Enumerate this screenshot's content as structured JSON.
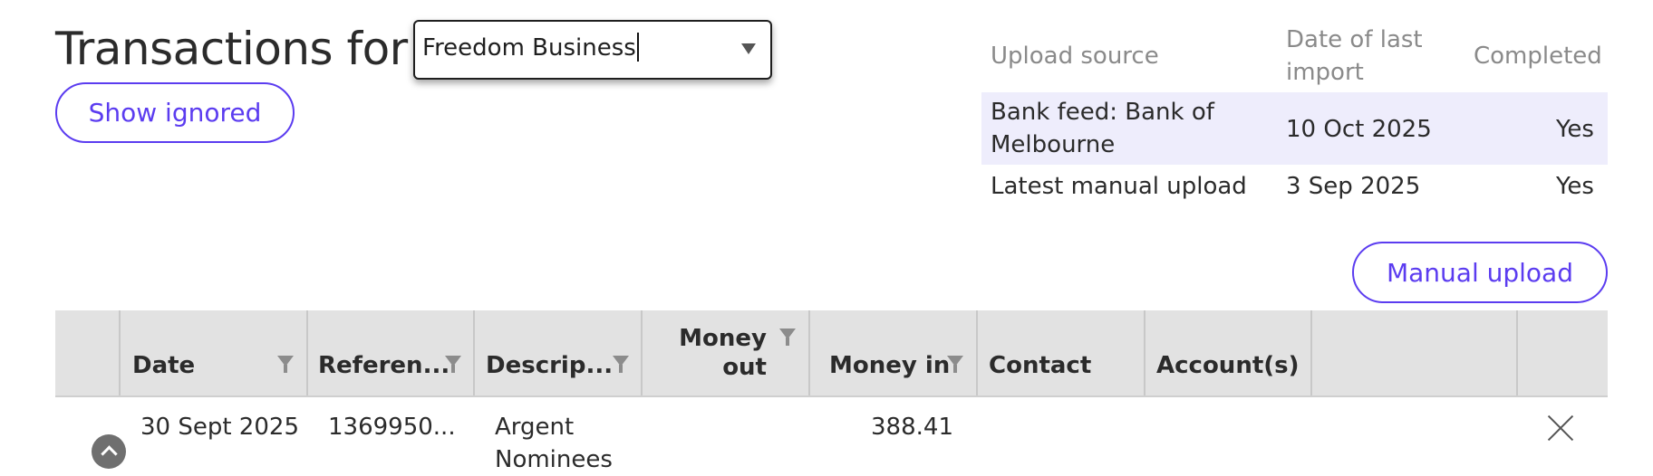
{
  "header": {
    "title": "Transactions for",
    "account_select": {
      "value": "Freedom Business"
    },
    "show_ignored_label": "Show ignored"
  },
  "upload_sources": {
    "columns": [
      "Upload source",
      "Date of last import",
      "Completed"
    ],
    "rows": [
      {
        "source": "Bank feed: Bank of Melbourne",
        "date": "10 Oct 2025",
        "completed": "Yes"
      },
      {
        "source": "Latest manual upload",
        "date": "3 Sep 2025",
        "completed": "Yes"
      }
    ],
    "manual_upload_label": "Manual upload"
  },
  "grid": {
    "columns": [
      "Date",
      "Referen...",
      "Descrip...",
      "Money out",
      "Money in",
      "Contact",
      "Account(s)"
    ],
    "money_out_lines": [
      "Money",
      "out"
    ],
    "rows": [
      {
        "date": "30 Sept 2025",
        "reference": "1369950...",
        "description_lines": [
          "Argent",
          "Nominees"
        ],
        "money_out": "",
        "money_in": "388.41",
        "contact": "",
        "accounts": ""
      }
    ]
  },
  "icons": [
    "chevron-down-icon",
    "filter-icon",
    "expand-icon",
    "close-icon"
  ],
  "colors": {
    "accent": "#5b3cf0",
    "header_bg": "#e2e2e2",
    "highlight_row": "#eeedfc"
  }
}
